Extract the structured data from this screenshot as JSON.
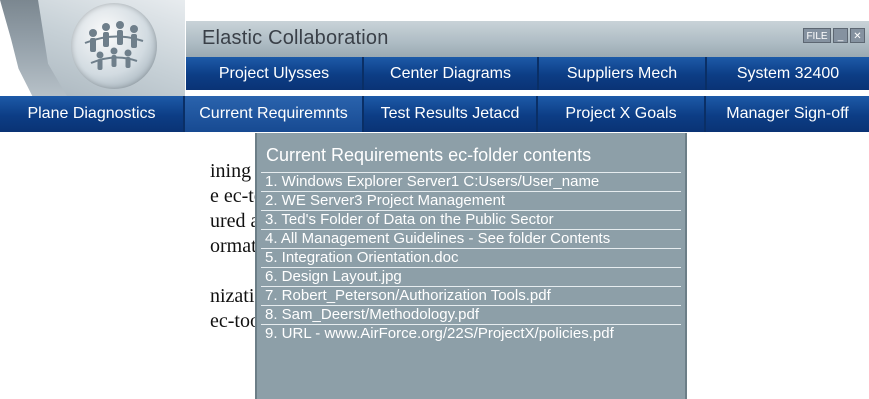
{
  "app": {
    "title": "Elastic Collaboration"
  },
  "window_controls": {
    "file_label": "FILE",
    "minimize_label": "_",
    "close_label": "✕"
  },
  "toolbar": {
    "row1": [
      {
        "label": "Project Ulysses"
      },
      {
        "label": "Center Diagrams"
      },
      {
        "label": "Suppliers Mech"
      },
      {
        "label": "System 32400"
      }
    ],
    "row2": [
      {
        "label": "Plane Diagnostics"
      },
      {
        "label": "Current Requiremnts"
      },
      {
        "label": "Test Results Jetacd"
      },
      {
        "label": "Project X Goals"
      },
      {
        "label": "Manager Sign-off"
      }
    ]
  },
  "dropdown": {
    "header_bold": "Current Requirements",
    "header_rest": " ec-folder contents",
    "items": [
      "1. Windows Explorer Server1 C:Users/User_name",
      "2. WE Server3 Project Management",
      "3. Ted's Folder of Data on the Public Sector",
      "4. All Management Guidelines - See folder Contents",
      "5. Integration Orientation.doc",
      "6. Design Layout.jpg",
      "7. Robert_Peterson/Authorization Tools.pdf",
      "8. Sam_Deerst/Methodology.pdf",
      "9. URL - www.AirForce.org/22S/ProjectX/policies.pdf"
    ]
  },
  "background_doc": {
    "lines": [
      "ining many",
      "e ec-toolbar,",
      "ured and",
      "ormation silos.",
      "nization can",
      "ec-toolbars"
    ]
  },
  "colors": {
    "toolbar_blue": "#0f3e84",
    "title_bar_gray": "#aebcc4",
    "dropdown_bg": "#8d9fa8"
  },
  "icons": {
    "logo": "people-globe-icon"
  }
}
